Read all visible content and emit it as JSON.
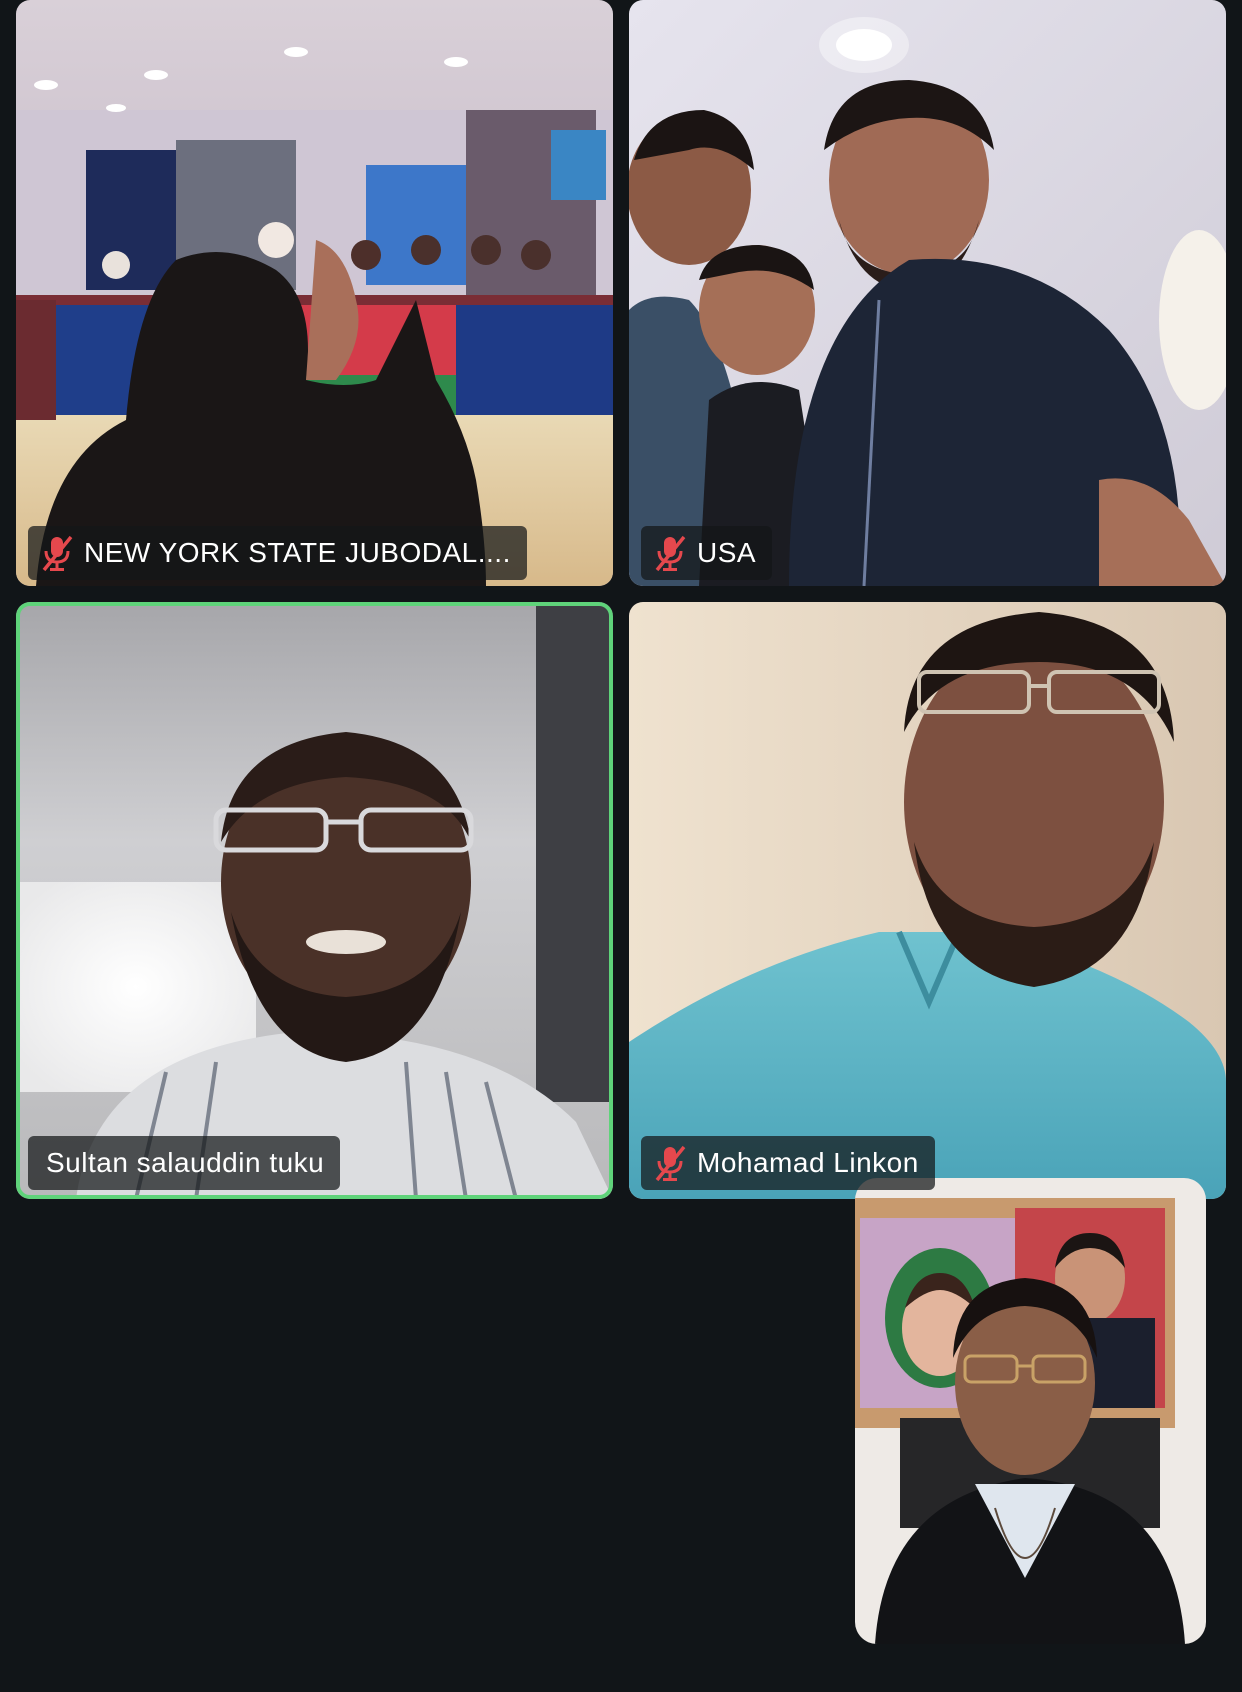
{
  "participants": [
    {
      "name": "NEW YORK STATE JUBODAL....",
      "muted": true,
      "speaking": false,
      "icon": "mic-muted-icon"
    },
    {
      "name": "USA",
      "muted": true,
      "speaking": false,
      "icon": "mic-muted-icon"
    },
    {
      "name": "Sultan salauddin tuku",
      "muted": false,
      "speaking": true
    },
    {
      "name": "Mohamad Linkon",
      "muted": true,
      "speaking": false,
      "icon": "mic-muted-icon"
    }
  ],
  "colors": {
    "background": "#111518",
    "active_speaker_border": "#5fd37a",
    "muted_icon": "#e5484d"
  }
}
